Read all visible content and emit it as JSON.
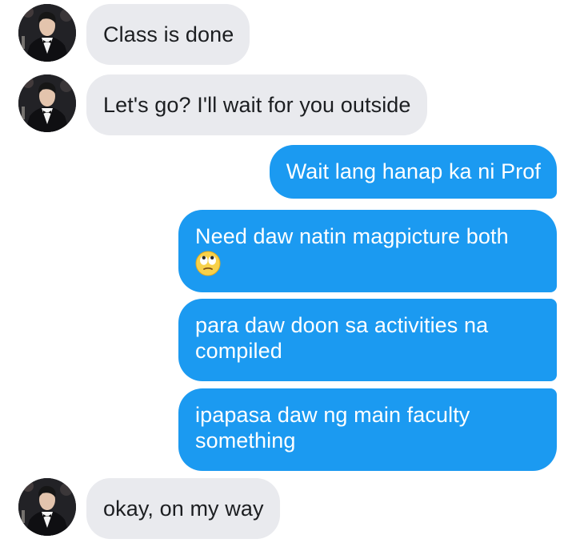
{
  "conversation": {
    "messages": [
      {
        "sender": "contact",
        "text": "Class is done"
      },
      {
        "sender": "contact",
        "text": "Let's go? I'll wait for you outside"
      },
      {
        "sender": "me",
        "text": "Wait lang hanap ka ni Prof"
      },
      {
        "sender": "me",
        "text": "Need daw natin magpicture both",
        "emoji": "eye-roll-emoji"
      },
      {
        "sender": "me",
        "lines": [
          "para daw doon sa activities na",
          "compiled"
        ]
      },
      {
        "sender": "me",
        "lines": [
          "ipapasa daw ng main faculty",
          "something"
        ]
      },
      {
        "sender": "contact",
        "text": "okay, on my way"
      }
    ]
  },
  "colors": {
    "outgoing_bubble": "#1b9af1",
    "incoming_bubble": "#e9eaee",
    "incoming_text": "#1c1e21",
    "outgoing_text": "#ffffff"
  },
  "icons": {
    "avatar": "contact-avatar",
    "emoji": "eye-roll-emoji"
  }
}
